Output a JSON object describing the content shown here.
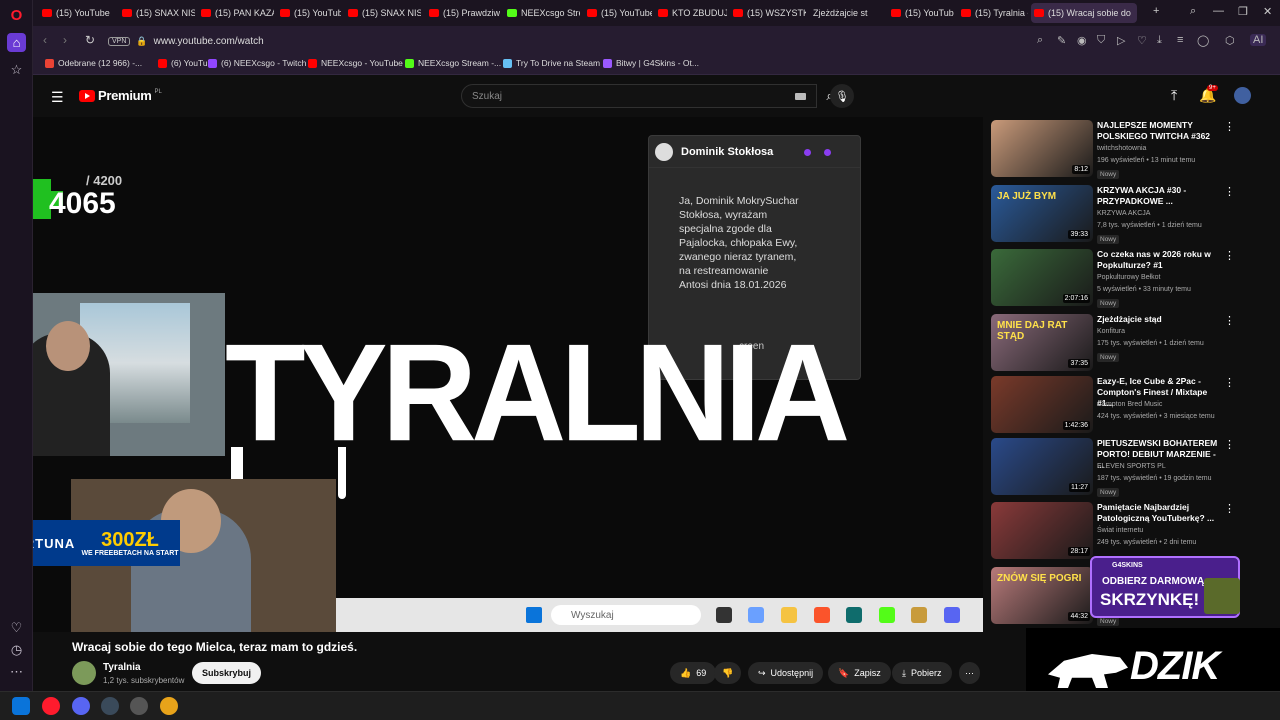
{
  "browser": {
    "tabs": [
      {
        "label": "(15) YouTube",
        "fav": "youtube"
      },
      {
        "label": "(15) SNAX NIS",
        "fav": "youtube"
      },
      {
        "label": "(15) PAN KAZA",
        "fav": "youtube"
      },
      {
        "label": "(15) YouTube",
        "fav": "youtube"
      },
      {
        "label": "(15) SNAX NIS",
        "fav": "youtube"
      },
      {
        "label": "(15) Prawdziw",
        "fav": "youtube"
      },
      {
        "label": "NEEXcsgo Stre",
        "fav": "kick"
      },
      {
        "label": "(15) YouTube",
        "fav": "youtube"
      },
      {
        "label": "KTO ZBUDUJE",
        "fav": "youtube"
      },
      {
        "label": "(15) WSZYSTK",
        "fav": "youtube"
      },
      {
        "label": "Zjeżdżajcie st",
        "fav": "none"
      },
      {
        "label": "(15) YouTube",
        "fav": "youtube"
      },
      {
        "label": "(15) Tyralnia -",
        "fav": "youtube"
      },
      {
        "label": "(15) Wracaj sobie do",
        "fav": "youtube"
      }
    ],
    "url": "www.youtube.com/watch",
    "vpn_label": "VPN",
    "ai_label": "AI",
    "bookmarks": [
      {
        "label": "Odebrane (12 966) -...",
        "color": "#ea4335"
      },
      {
        "label": "(6) YouTube",
        "color": "#ff0000"
      },
      {
        "label": "(6) NEEXcsgo - Twitch",
        "color": "#9146ff"
      },
      {
        "label": "NEEXcsgo - YouTube",
        "color": "#ff0000"
      },
      {
        "label": "NEEXcsgo Stream -...",
        "color": "#53fc18"
      },
      {
        "label": "Try To Drive na Steam",
        "color": "#66c0f4"
      },
      {
        "label": "Bitwy | G4Skins - Ot...",
        "color": "#9b59ff"
      }
    ]
  },
  "youtube": {
    "logo_text": "Premium",
    "logo_region": "PL",
    "search_placeholder": "Szukaj",
    "notification_count": "9+",
    "video": {
      "counter_total": "/ 4200",
      "counter_value": "4065",
      "chat_name": "Dominik Stokłosa",
      "chat_message": "Ja, Dominik MokrySuchar Stokłosa, wyrażam specjalna zgode dla Pajalocka, chłopaka Ewy, zwanego nieraz tyranem, na restreamowanie Antosi dnia 18.01.2026",
      "chat_footer_fragment": "creen",
      "overlay_title": "TYRALNIA",
      "fortuna_logo": "FORTUNA",
      "fortuna_amount": "300ZŁ",
      "fortuna_sub": "WE FREEBETACH NA START",
      "win_search_placeholder": "Wyszukaj"
    },
    "title": "Wracaj sobie do tego Mielca, teraz mam to gdzieś.",
    "channel": {
      "name": "Tyralnia",
      "subs": "1,2 tys. subskrybentów"
    },
    "subscribe_label": "Subskrybuj",
    "actions": {
      "likes": "69",
      "share": "Udostępnij",
      "save": "Zapisz",
      "download": "Pobierz"
    },
    "recommendations": [
      {
        "title": "NAJLEPSZE MOMENTY POLSKIEGO TWITCHA #362",
        "channel": "twitchshotownia",
        "meta": "196 wyświetleń • 13 minut temu",
        "badge": "Nowy",
        "duration": "8:12",
        "color": "#c99a7a"
      },
      {
        "title": "KRZYWA AKCJA #30 - PRZYPADKOWE ...",
        "channel": "KRZYWA AKCJA",
        "meta": "7,8 tys. wyświetleń • 1 dzień temu",
        "badge": "Nowy",
        "duration": "39:33",
        "color": "#2a5a9a",
        "thumb_text": "JA JUŻ BYM"
      },
      {
        "title": "Co czeka nas w 2026 roku w Popkulturze? #1",
        "channel": "Popkulturowy Bełkot",
        "meta": "5 wyświetleń • 33 minuty temu",
        "badge": "Nowy",
        "duration": "2:07:16",
        "color": "#3a6a3a"
      },
      {
        "title": "Zjeżdżajcie stąd",
        "channel": "Konfitura",
        "meta": "175 tys. wyświetleń • 1 dzień temu",
        "badge": "Nowy",
        "duration": "37:35",
        "color": "#8a6a7a",
        "thumb_text": "MNIE DAJ RAT STĄD"
      },
      {
        "title": "Eazy-E, Ice Cube & 2Pac - Compton's Finest / Mixtape #1...",
        "channel": "Compton Bred Music",
        "meta": "424 tys. wyświetleń • 3 miesiące temu",
        "badge": "",
        "duration": "1:42:36",
        "color": "#7a3a2a"
      },
      {
        "title": "PIETUSZEWSKI BOHATEREM PORTO! DEBIUT MARZENIE - ...",
        "channel": "ELEVEN SPORTS PL",
        "meta": "187 tys. wyświetleń • 19 godzin temu",
        "badge": "Nowy",
        "duration": "11:27",
        "color": "#2a4a8a"
      },
      {
        "title": "Pamiętacie Najbardziej Patologiczną YouTuberkę? ...",
        "channel": "Świat internetu",
        "meta": "249 tys. wyświetleń • 2 dni temu",
        "badge": "",
        "duration": "28:17",
        "color": "#8a3a3a"
      },
      {
        "title": "",
        "channel": "",
        "meta": "",
        "badge": "Nowy",
        "duration": "44:32",
        "color": "#b87a7a",
        "thumb_text": "ZNÓW SIĘ POGRI"
      }
    ],
    "ads": {
      "g4_brand": "G4SKINS",
      "g4_line1": "ODBIERZ DARMOWĄ",
      "g4_line2": "SKRZYNKĘ!",
      "dzik": "DZIK"
    }
  }
}
